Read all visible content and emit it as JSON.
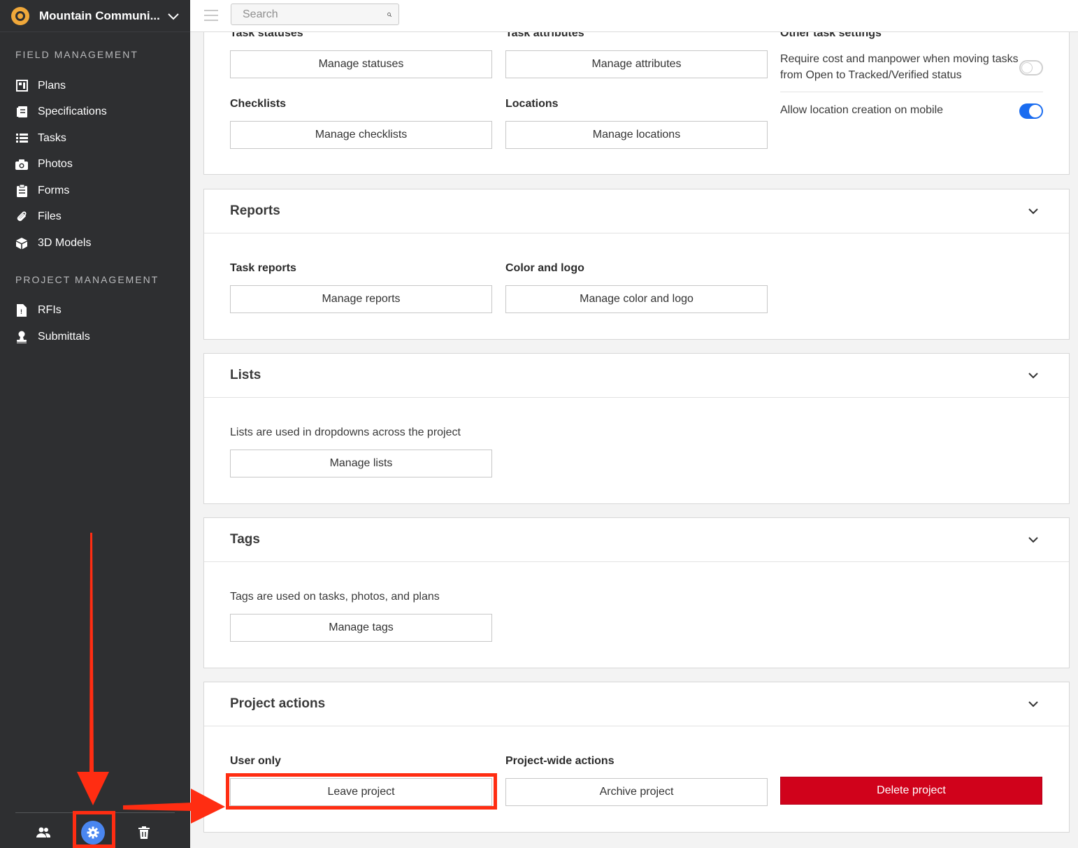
{
  "sidebar": {
    "project_name": "Mountain Communi...",
    "sections": [
      {
        "label": "FIELD MANAGEMENT",
        "items": [
          {
            "label": "Plans",
            "icon": "plans-icon"
          },
          {
            "label": "Specifications",
            "icon": "specifications-icon"
          },
          {
            "label": "Tasks",
            "icon": "tasks-icon"
          },
          {
            "label": "Photos",
            "icon": "camera-icon"
          },
          {
            "label": "Forms",
            "icon": "clipboard-icon"
          },
          {
            "label": "Files",
            "icon": "paperclip-icon"
          },
          {
            "label": "3D Models",
            "icon": "cube-icon"
          }
        ]
      },
      {
        "label": "PROJECT MANAGEMENT",
        "items": [
          {
            "label": "RFIs",
            "icon": "rfi-document-icon"
          },
          {
            "label": "Submittals",
            "icon": "submittals-stamp-icon"
          }
        ]
      }
    ],
    "footer": {
      "people": "people-icon",
      "settings": "gear-icon",
      "trash": "trash-icon"
    }
  },
  "topbar": {
    "search_placeholder": "Search"
  },
  "tasks_card": {
    "statuses_label": "Task statuses",
    "statuses_button": "Manage statuses",
    "attributes_label": "Task attributes",
    "attributes_button": "Manage attributes",
    "checklists_label": "Checklists",
    "checklists_button": "Manage checklists",
    "locations_label": "Locations",
    "locations_button": "Manage locations",
    "other_label": "Other task settings",
    "setting1_line1": "Require cost and manpower when moving tasks",
    "setting1_line2": "from Open to Tracked/Verified status",
    "setting1_on": false,
    "setting2": "Allow location creation on mobile",
    "setting2_on": true
  },
  "reports_card": {
    "title": "Reports",
    "task_reports_label": "Task reports",
    "task_reports_button": "Manage reports",
    "color_logo_label": "Color and logo",
    "color_logo_button": "Manage color and logo"
  },
  "lists_card": {
    "title": "Lists",
    "description": "Lists are used in dropdowns across the project",
    "button": "Manage lists"
  },
  "tags_card": {
    "title": "Tags",
    "description": "Tags are used on tasks, photos, and plans",
    "button": "Manage tags"
  },
  "actions_card": {
    "title": "Project actions",
    "user_only_label": "User only",
    "leave_button": "Leave project",
    "project_wide_label": "Project-wide actions",
    "archive_button": "Archive project",
    "delete_button": "Delete project"
  },
  "colors": {
    "sidebar_bg": "#2e2f31",
    "accent_blue": "#1a6cf0",
    "danger_red": "#d0021b",
    "annotation_red": "#ff2d12"
  }
}
